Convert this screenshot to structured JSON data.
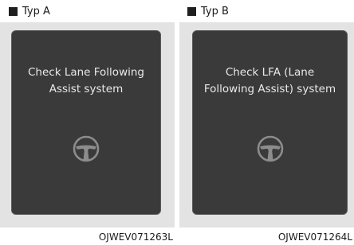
{
  "panels": [
    {
      "label": "Typ A",
      "message_lines": [
        "Check Lane Following",
        "Assist system"
      ],
      "icon": "steering-wheel-icon",
      "code": "OJWEV071263L"
    },
    {
      "label": "Typ B",
      "message_lines": [
        "Check LFA (Lane",
        "Following Assist) system"
      ],
      "icon": "steering-wheel-icon",
      "code": "OJWEV071264L"
    }
  ],
  "colors": {
    "screen": "#3a3a3a",
    "screen_border": "#5a5a5a",
    "panel_background": "#e3e3e3",
    "message_text": "#e9e9e9",
    "icon": "#8c8c8c"
  }
}
